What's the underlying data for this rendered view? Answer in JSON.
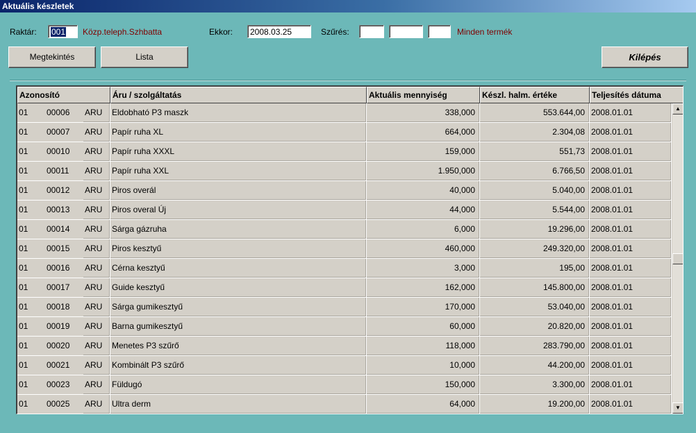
{
  "window": {
    "title": "Aktuális készletek"
  },
  "filters": {
    "raktar_label": "Raktár:",
    "raktar_value": "001",
    "raktar_name": "Közp.teleph.Szhbatta",
    "ekkor_label": "Ekkor:",
    "ekkor_value": "2008.03.25",
    "szures_label": "Szűrés:",
    "szures_1": "",
    "szures_2": "",
    "szures_3": "",
    "szures_desc": "Minden termék"
  },
  "buttons": {
    "megtekintes": "Megtekintés",
    "lista": "Lista",
    "kilepes": "Kilépés"
  },
  "table": {
    "headers": [
      "Azonosító",
      "Áru / szolgáltatás",
      "Aktuális mennyiség",
      "Készl. halm. értéke",
      "Teljesítés dátuma"
    ],
    "rows": [
      {
        "g": "01",
        "id": "00006",
        "type": "ARU",
        "name": "Eldobható P3 maszk",
        "qty": "338,000",
        "value": "553.644,00",
        "date": "2008.01.01"
      },
      {
        "g": "01",
        "id": "00007",
        "type": "ARU",
        "name": "Papír ruha XL",
        "qty": "664,000",
        "value": "2.304,08",
        "date": "2008.01.01"
      },
      {
        "g": "01",
        "id": "00010",
        "type": "ARU",
        "name": "Papír ruha XXXL",
        "qty": "159,000",
        "value": "551,73",
        "date": "2008.01.01"
      },
      {
        "g": "01",
        "id": "00011",
        "type": "ARU",
        "name": "Papír ruha XXL",
        "qty": "1.950,000",
        "value": "6.766,50",
        "date": "2008.01.01"
      },
      {
        "g": "01",
        "id": "00012",
        "type": "ARU",
        "name": "Piros overál",
        "qty": "40,000",
        "value": "5.040,00",
        "date": "2008.01.01"
      },
      {
        "g": "01",
        "id": "00013",
        "type": "ARU",
        "name": "Piros overal Új",
        "qty": "44,000",
        "value": "5.544,00",
        "date": "2008.01.01"
      },
      {
        "g": "01",
        "id": "00014",
        "type": "ARU",
        "name": "Sárga gázruha",
        "qty": "6,000",
        "value": "19.296,00",
        "date": "2008.01.01"
      },
      {
        "g": "01",
        "id": "00015",
        "type": "ARU",
        "name": "Piros kesztyű",
        "qty": "460,000",
        "value": "249.320,00",
        "date": "2008.01.01"
      },
      {
        "g": "01",
        "id": "00016",
        "type": "ARU",
        "name": "Cérna kesztyű",
        "qty": "3,000",
        "value": "195,00",
        "date": "2008.01.01"
      },
      {
        "g": "01",
        "id": "00017",
        "type": "ARU",
        "name": "Guide kesztyű",
        "qty": "162,000",
        "value": "145.800,00",
        "date": "2008.01.01"
      },
      {
        "g": "01",
        "id": "00018",
        "type": "ARU",
        "name": "Sárga gumikesztyű",
        "qty": "170,000",
        "value": "53.040,00",
        "date": "2008.01.01"
      },
      {
        "g": "01",
        "id": "00019",
        "type": "ARU",
        "name": "Barna gumikesztyű",
        "qty": "60,000",
        "value": "20.820,00",
        "date": "2008.01.01"
      },
      {
        "g": "01",
        "id": "00020",
        "type": "ARU",
        "name": "Menetes P3 szűrő",
        "qty": "118,000",
        "value": "283.790,00",
        "date": "2008.01.01"
      },
      {
        "g": "01",
        "id": "00021",
        "type": "ARU",
        "name": "Kombinált P3 szűrő",
        "qty": "10,000",
        "value": "44.200,00",
        "date": "2008.01.01"
      },
      {
        "g": "01",
        "id": "00023",
        "type": "ARU",
        "name": "Füldugó",
        "qty": "150,000",
        "value": "3.300,00",
        "date": "2008.01.01"
      },
      {
        "g": "01",
        "id": "00025",
        "type": "ARU",
        "name": "Ultra derm",
        "qty": "64,000",
        "value": "19.200,00",
        "date": "2008.01.01"
      }
    ]
  },
  "scrollbar": {
    "up_icon": "arrow-up-icon",
    "down_icon": "arrow-down-icon"
  }
}
